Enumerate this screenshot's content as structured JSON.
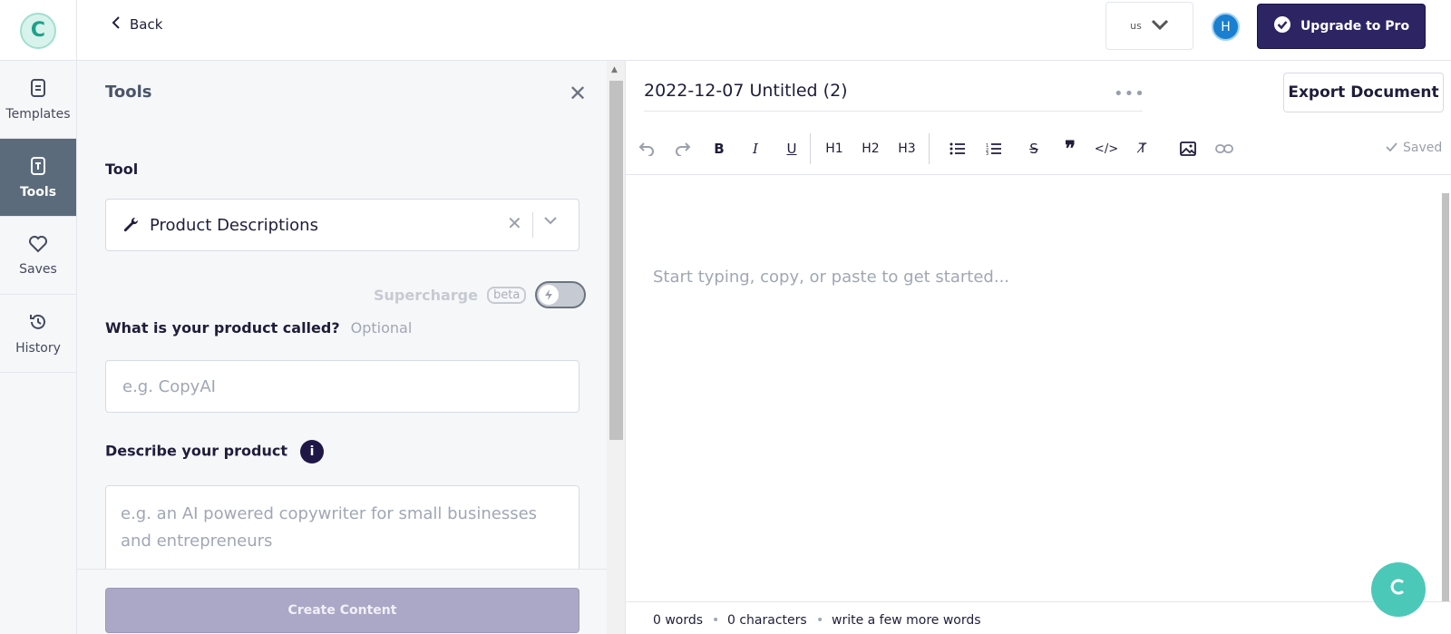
{
  "header": {
    "logo_letter": "C",
    "back_label": "Back",
    "language": "us",
    "avatar_initial": "H",
    "upgrade_label": "Upgrade to Pro"
  },
  "sidenav": {
    "items": [
      {
        "label": "Templates",
        "icon": "template-icon"
      },
      {
        "label": "Tools",
        "icon": "tools-icon",
        "active": true
      },
      {
        "label": "Saves",
        "icon": "heart-icon"
      },
      {
        "label": "History",
        "icon": "history-icon"
      }
    ]
  },
  "tools_panel": {
    "title": "Tools",
    "tool_label": "Tool",
    "tool_value": "Product Descriptions",
    "supercharge_label": "Supercharge",
    "beta_label": "beta",
    "product_name_label": "What is your product called?",
    "product_name_optional": "Optional",
    "product_name_placeholder": "e.g. CopyAI",
    "describe_label": "Describe your product",
    "describe_placeholder": "e.g. an AI powered copywriter for small businesses and entrepreneurs",
    "create_label": "Create Content"
  },
  "editor": {
    "doc_title": "2022-12-07 Untitled (2)",
    "export_label": "Export Document",
    "saved_label": "Saved",
    "placeholder": "Start typing, copy, or paste to get started...",
    "status": {
      "words": "0 words",
      "characters": "0 characters",
      "hint": "write a few more words"
    },
    "toolbar": {
      "h1": "H1",
      "h2": "H2",
      "h3": "H3"
    }
  },
  "colors": {
    "brand_dark": "#2d2464",
    "accent_teal": "#4cc8b8",
    "nav_active": "#5b6b7b"
  }
}
